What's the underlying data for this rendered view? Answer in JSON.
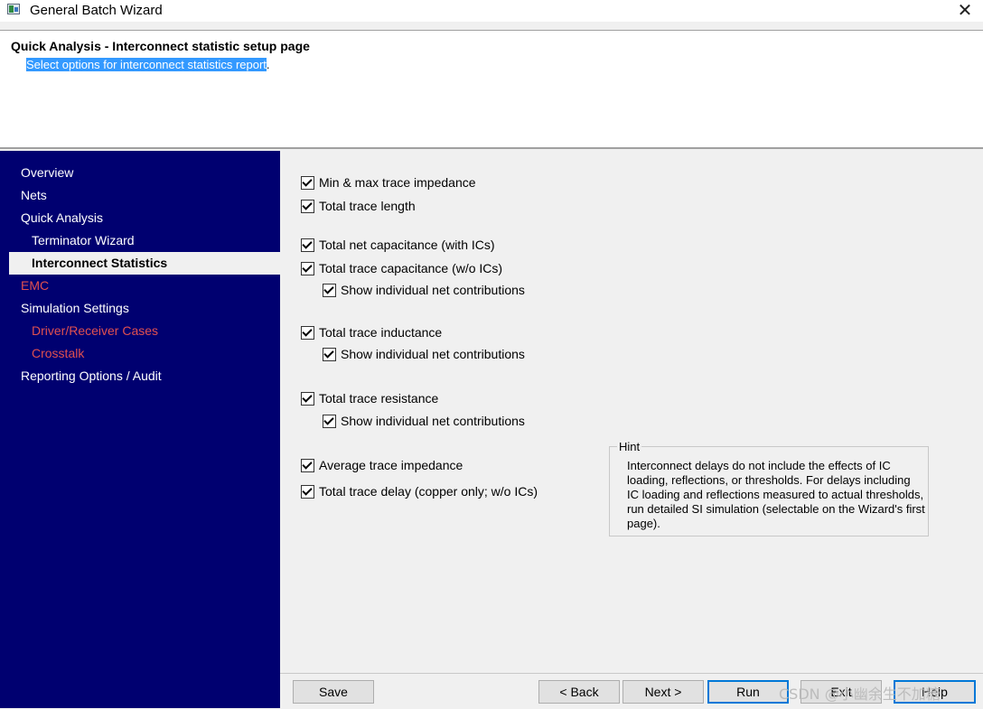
{
  "window": {
    "title": "General Batch Wizard",
    "close_glyph": "✕",
    "app_icon": "app-window-icon"
  },
  "header": {
    "title": "Quick Analysis - Interconnect statistic setup page",
    "subtitle_selected": "Select options for interconnect statistics report",
    "subtitle_rest": "."
  },
  "sidebar": {
    "items": [
      {
        "label": "Overview"
      },
      {
        "label": "Nets"
      },
      {
        "label": "Quick Analysis"
      },
      {
        "label": "Terminator Wizard"
      },
      {
        "label": "Interconnect Statistics"
      },
      {
        "label": "EMC"
      },
      {
        "label": "Simulation Settings"
      },
      {
        "label": "Driver/Receiver Cases"
      },
      {
        "label": "Crosstalk"
      },
      {
        "label": "Reporting Options / Audit"
      }
    ],
    "selected": "Interconnect Statistics",
    "background": "#000070",
    "disabled_color": "#e05050"
  },
  "options": {
    "items": [
      {
        "label": "Min & max trace impedance",
        "checked": true
      },
      {
        "label": "Total trace length",
        "checked": true
      },
      {
        "label": "Total net capacitance  (with ICs)",
        "checked": true
      },
      {
        "label": "Total trace capacitance  (w/o  ICs)",
        "checked": true
      },
      {
        "label": "Show individual net contributions",
        "checked": true
      },
      {
        "label": "Total trace inductance",
        "checked": true
      },
      {
        "label": "Show individual net contributions",
        "checked": true
      },
      {
        "label": "Total trace resistance",
        "checked": true
      },
      {
        "label": "Show individual net contributions",
        "checked": true
      },
      {
        "label": "Average trace impedance",
        "checked": true
      },
      {
        "label": "Total trace delay (copper only; w/o ICs)",
        "checked": true
      }
    ]
  },
  "hint": {
    "legend": "Hint",
    "text": "Interconnect delays do not include the effects of IC loading, reflections, or thresholds.  For delays including IC loading and reflections measured to actual thresholds, run detailed SI simulation (selectable on the Wizard's first page)."
  },
  "buttons": {
    "save": "Save",
    "back": "< Back",
    "next": "Next >",
    "run": "Run",
    "exit": "Exit",
    "help": "Help"
  },
  "watermark": "CSDN @小幽余生不加糖",
  "colors": {
    "accent": "#0078d7",
    "selection": "#3399ff"
  }
}
